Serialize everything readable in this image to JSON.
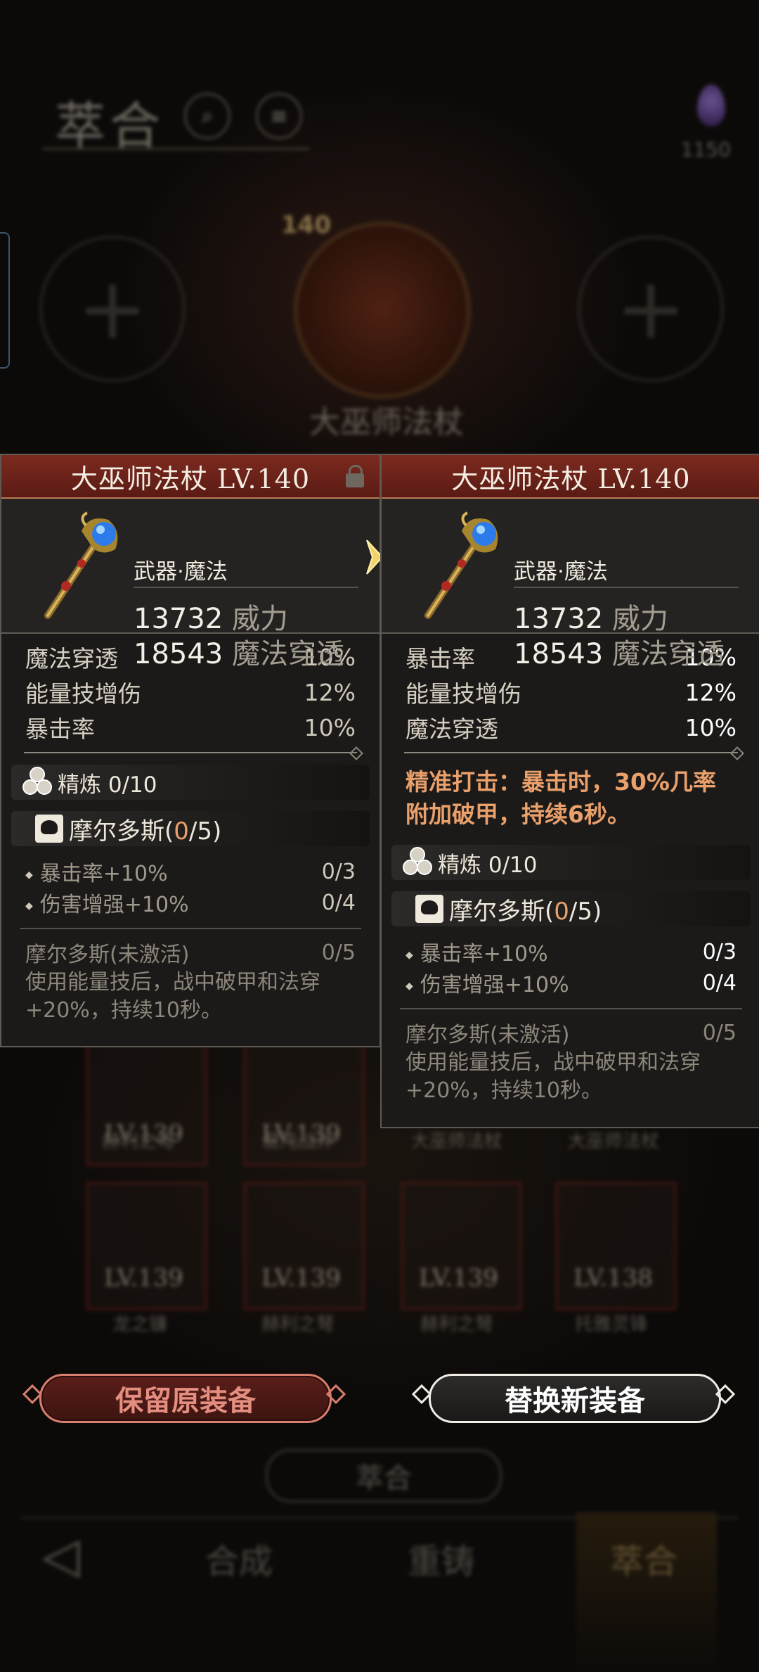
{
  "background": {
    "title": "萃合",
    "gem_count": "1150",
    "center_level": "140",
    "center_name": "大巫师法杖",
    "cards_row1": [
      {
        "lv": "LV.139",
        "name": "赫利之弩"
      },
      {
        "lv": "LV.139",
        "name": "混沌战斧"
      },
      {
        "lv": "",
        "name": "大巫师法杖"
      },
      {
        "lv": "",
        "name": "大巫师法杖"
      }
    ],
    "cards_row2": [
      {
        "lv": "LV.139",
        "name": "龙之镰"
      },
      {
        "lv": "LV.139",
        "name": "赫利之弩"
      },
      {
        "lv": "LV.139",
        "name": "赫利之弩"
      },
      {
        "lv": "LV.138",
        "name": "托雅灵锋"
      }
    ],
    "merge_button": "萃合",
    "nav": {
      "tab1": "合成",
      "tab2": "重铸",
      "tab3": "萃合"
    }
  },
  "left_panel": {
    "title": "大巫师法杖 LV.140",
    "type": "武器·魔法",
    "power_value": "13732",
    "power_label": "威力",
    "pen_value": "18543",
    "pen_label": "魔法穿透",
    "stats": [
      {
        "k": "魔法穿透",
        "v": "10%"
      },
      {
        "k": "能量技增伤",
        "v": "12%"
      },
      {
        "k": "暴击率",
        "v": "10%"
      }
    ],
    "refine": "精炼 0/10",
    "set_name": "摩尔多斯(",
    "set_cur": "0",
    "set_tail": "/5)",
    "bonuses": [
      {
        "k": "暴击率+10%",
        "v": "0/3"
      },
      {
        "k": "伤害增强+10%",
        "v": "0/4"
      }
    ],
    "inactive_title": "摩尔多斯(未激活)",
    "inactive_count": "0/5",
    "inactive_desc": "使用能量技后，战中破甲和法穿+20%，持续10秒。"
  },
  "right_panel": {
    "title": "大巫师法杖 LV.140",
    "type": "武器·魔法",
    "power_value": "13732",
    "power_label": "威力",
    "pen_value": "18543",
    "pen_label": "魔法穿透",
    "stats": [
      {
        "k": "暴击率",
        "v": "10%"
      },
      {
        "k": "能量技增伤",
        "v": "12%"
      },
      {
        "k": "魔法穿透",
        "v": "10%"
      }
    ],
    "special_line1": "精准打击：暴击时，30%几率",
    "special_line2": "附加破甲，持续6秒。",
    "refine": "精炼 0/10",
    "set_name": "摩尔多斯(",
    "set_cur": "0",
    "set_tail": "/5)",
    "bonuses": [
      {
        "k": "暴击率+10%",
        "v": "0/3"
      },
      {
        "k": "伤害增强+10%",
        "v": "0/4"
      }
    ],
    "inactive_title": "摩尔多斯(未激活)",
    "inactive_count": "0/5",
    "inactive_desc": "使用能量技后，战中破甲和法穿+20%，持续10秒。"
  },
  "buttons": {
    "keep": "保留原装备",
    "replace": "替换新装备"
  },
  "colors": {
    "header_red": "#7d2a1f",
    "highlight_orange": "#e9a06b",
    "keep_border": "#d77e6e"
  }
}
